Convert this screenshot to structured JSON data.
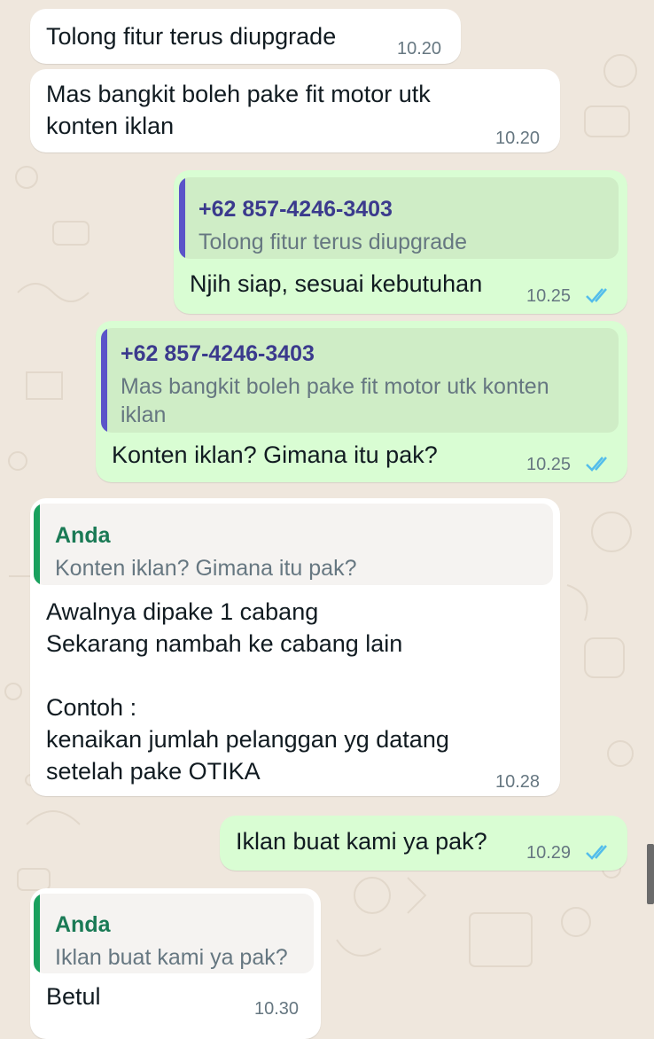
{
  "messages": [
    {
      "text": "Tolong fitur terus diupgrade",
      "time": "10.20"
    },
    {
      "text": "Mas bangkit boleh pake fit motor utk\nkonten iklan",
      "time": "10.20"
    },
    {
      "quote_author": "+62 857-4246-3403",
      "quote_text": "Tolong fitur terus diupgrade",
      "text": "Njih siap, sesuai kebutuhan",
      "time": "10.25"
    },
    {
      "quote_author": "+62 857-4246-3403",
      "quote_text": "Mas bangkit boleh pake fit motor utk konten\niklan",
      "text": "Konten iklan? Gimana itu pak?",
      "time": "10.25"
    },
    {
      "quote_author": "Anda",
      "quote_text": "Konten iklan? Gimana itu pak?",
      "text": "Awalnya dipake 1 cabang\nSekarang nambah ke cabang lain\n\nContoh :\nkenaikan jumlah pelanggan yg datang\nsetelah pake OTIKA",
      "time": "10.28"
    },
    {
      "text": "Iklan buat kami ya pak?",
      "time": "10.29"
    },
    {
      "quote_author": "Anda",
      "quote_text": "Iklan buat kami ya pak?",
      "text": "Betul",
      "time": "10.30"
    }
  ],
  "colors": {
    "background": "#efe7dd",
    "incoming_bubble": "#ffffff",
    "outgoing_bubble": "#d9fdd3",
    "read_ticks": "#53bdeb"
  },
  "icons": {
    "read_receipt": "double-check-icon"
  }
}
